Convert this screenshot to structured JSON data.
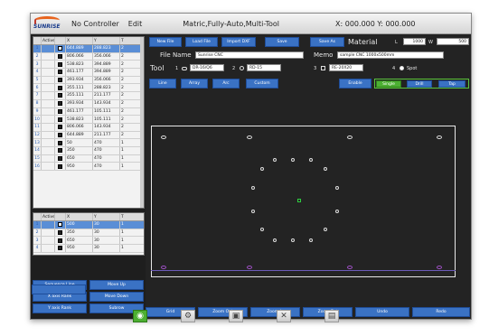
{
  "titlebar": {
    "logo_text": "SUNRISE",
    "controller": "No Controller",
    "edit": "Edit",
    "title": "Matric,Fully-Auto,Multi-Tool",
    "coords": "X: 000.000  Y: 000.000"
  },
  "upper_table": {
    "headers": [
      "",
      "Active",
      "X",
      "Y",
      "T"
    ],
    "rows": [
      {
        "n": "1",
        "x": "644.889",
        "y": "288.823",
        "t": "2",
        "selected": true
      },
      {
        "n": "2",
        "x": "806.066",
        "y": "356.066",
        "t": "2"
      },
      {
        "n": "3",
        "x": "538.823",
        "y": "394.889",
        "t": "2"
      },
      {
        "n": "4",
        "x": "461.177",
        "y": "394.889",
        "t": "2"
      },
      {
        "n": "5",
        "x": "393.934",
        "y": "356.066",
        "t": "2"
      },
      {
        "n": "6",
        "x": "355.111",
        "y": "288.823",
        "t": "2"
      },
      {
        "n": "7",
        "x": "355.111",
        "y": "211.177",
        "t": "2"
      },
      {
        "n": "8",
        "x": "393.934",
        "y": "143.934",
        "t": "2"
      },
      {
        "n": "9",
        "x": "461.177",
        "y": "105.111",
        "t": "2"
      },
      {
        "n": "10",
        "x": "538.823",
        "y": "105.111",
        "t": "2"
      },
      {
        "n": "11",
        "x": "806.066",
        "y": "143.934",
        "t": "2"
      },
      {
        "n": "12",
        "x": "644.889",
        "y": "211.177",
        "t": "2"
      },
      {
        "n": "13",
        "x": "50",
        "y": "470",
        "t": "1"
      },
      {
        "n": "14",
        "x": "350",
        "y": "470",
        "t": "1"
      },
      {
        "n": "15",
        "x": "650",
        "y": "470",
        "t": "1"
      },
      {
        "n": "16",
        "x": "950",
        "y": "470",
        "t": "1"
      }
    ]
  },
  "lower_table": {
    "headers": [
      "",
      "Active",
      "X",
      "Y",
      "T"
    ],
    "rows": [
      {
        "n": "1",
        "x": "500",
        "y": "30",
        "t": "1",
        "selected": true
      },
      {
        "n": "2",
        "x": "350",
        "y": "30",
        "t": "1"
      },
      {
        "n": "3",
        "x": "650",
        "y": "30",
        "t": "1"
      },
      {
        "n": "4",
        "x": "950",
        "y": "30",
        "t": "1"
      }
    ]
  },
  "left_buttons": {
    "sequence_line": "Sequence Line",
    "move_up": "Move Up",
    "x_axis_rank": "X axis Rank",
    "move_down": "Move Down",
    "y_axis_rank": "Y axis Rank",
    "subrow": "Subrow"
  },
  "top_buttons": {
    "new_file": "New File",
    "load_file": "Load File",
    "import_dxf": "Import DXF",
    "save": "Save",
    "save_as": "Save As"
  },
  "material": {
    "label": "Material",
    "l_label": "L",
    "l_value": "1000",
    "w_label": "W",
    "w_value": "500"
  },
  "file": {
    "label": "File Name",
    "value": "Sunrise CNC",
    "memo_label": "Memo",
    "memo_value": "sample CNC 1000x500mm"
  },
  "tool": {
    "label": "Tool",
    "t1_num": "1",
    "t1_value": "DR-16/Q6",
    "t2_num": "2",
    "t2_value": "RD-15",
    "t3_num": "3",
    "t3_value": "RE-20X20",
    "t4_num": "4",
    "t4_value": "Spot"
  },
  "mode_buttons": {
    "line": "Line",
    "array": "Array",
    "arc": "Arc",
    "custom": "Custom",
    "enable": "Enable",
    "single": "Single",
    "drill": "Drill",
    "tap": "Tap"
  },
  "bottom_buttons": [
    "Grid",
    "Zoom Out",
    "Zoom In",
    "Zoom Ext",
    "Undo",
    "Redo"
  ],
  "footer_icons": [
    "cnc-icon",
    "gear-icon",
    "disk-icon",
    "tools-icon",
    "book-icon"
  ],
  "colors": {
    "accent": "#3a72c4",
    "active": "#4caf32",
    "hole_outline": "#dddddd",
    "edge_hole": "#a050c8",
    "marker": "#2ecc40"
  }
}
